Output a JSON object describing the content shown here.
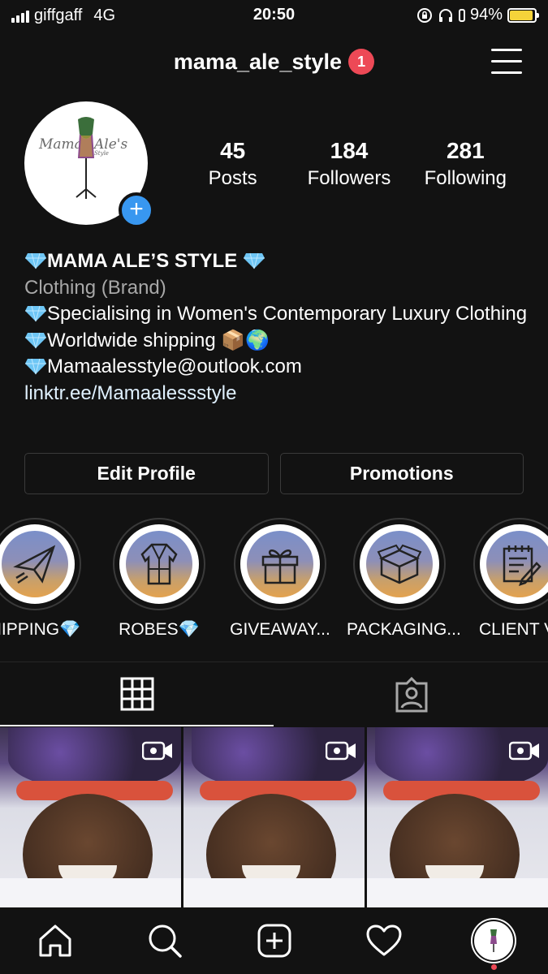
{
  "status_bar": {
    "carrier": "giffgaff",
    "network": "4G",
    "time": "20:50",
    "battery": "94%",
    "battery_level": 0.94
  },
  "header": {
    "username": "mama_ale_style",
    "notification_count": "1"
  },
  "profile": {
    "avatar_logo_text": "Mama Ale's Style",
    "stats": [
      {
        "value": "45",
        "label": "Posts"
      },
      {
        "value": "184",
        "label": "Followers"
      },
      {
        "value": "281",
        "label": "Following"
      }
    ]
  },
  "bio": {
    "name": "MAMA ALE’S STYLE",
    "category": "Clothing (Brand)",
    "line1": "Specialising in Women's Contemporary Luxury Clothing",
    "line2": "Worldwide shipping 📦🌍",
    "line3": "Mamaalesstyle@outlook.com",
    "link": "linktr.ee/Mamaalessstyle"
  },
  "buttons": {
    "edit_profile": "Edit Profile",
    "promotions": "Promotions"
  },
  "highlights": [
    {
      "label": "HIPPING💎",
      "icon": "paper-plane-icon"
    },
    {
      "label": "ROBES💎",
      "icon": "robe-icon"
    },
    {
      "label": "GIVEAWAY...",
      "icon": "gift-icon"
    },
    {
      "label": "PACKAGING...",
      "icon": "box-icon"
    },
    {
      "label": "CLIENT VI",
      "icon": "notepad-icon"
    }
  ],
  "tabs": [
    {
      "icon": "grid-icon",
      "active": true
    },
    {
      "icon": "tagged-icon",
      "active": false
    }
  ],
  "posts_count_visible": 3,
  "bottom_nav": [
    "home-icon",
    "search-icon",
    "add-icon",
    "heart-icon",
    "profile-icon"
  ],
  "colors": {
    "background": "#121212",
    "notification": "#ed4956",
    "accent_blue": "#3897f0",
    "battery": "#f5d33a"
  }
}
